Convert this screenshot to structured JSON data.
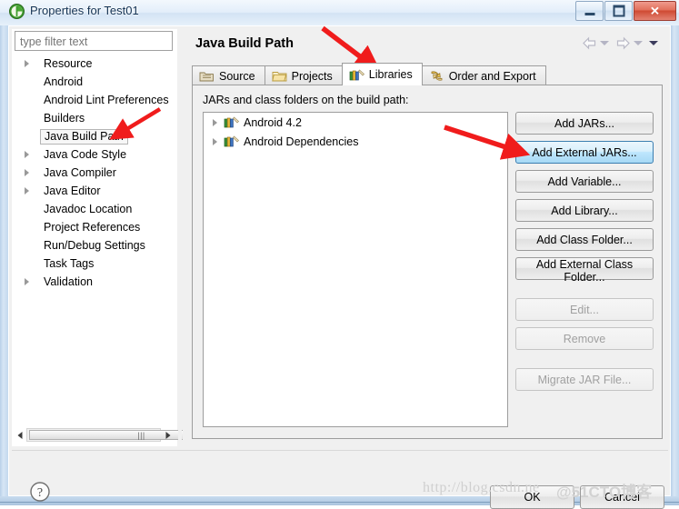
{
  "window": {
    "title": "Properties for Test01",
    "icon": "eclipse-properties-icon",
    "minimize_label": "",
    "maximize_label": "",
    "close_label": "✕"
  },
  "sidebar": {
    "filter": {
      "placeholder": "type filter text",
      "value": ""
    },
    "items": [
      {
        "label": "Resource",
        "expandable": true,
        "selected": false
      },
      {
        "label": "Android",
        "expandable": false,
        "selected": false
      },
      {
        "label": "Android Lint Preferences",
        "expandable": false,
        "selected": false
      },
      {
        "label": "Builders",
        "expandable": false,
        "selected": false
      },
      {
        "label": "Java Build Path",
        "expandable": false,
        "selected": true
      },
      {
        "label": "Java Code Style",
        "expandable": true,
        "selected": false
      },
      {
        "label": "Java Compiler",
        "expandable": true,
        "selected": false
      },
      {
        "label": "Java Editor",
        "expandable": true,
        "selected": false
      },
      {
        "label": "Javadoc Location",
        "expandable": false,
        "selected": false
      },
      {
        "label": "Project References",
        "expandable": false,
        "selected": false
      },
      {
        "label": "Run/Debug Settings",
        "expandable": false,
        "selected": false
      },
      {
        "label": "Task Tags",
        "expandable": false,
        "selected": false
      },
      {
        "label": "Validation",
        "expandable": true,
        "selected": false
      }
    ],
    "scrollbar": {
      "left_arrow": "◀",
      "right_arrow": "▶",
      "grip": "‖‖"
    }
  },
  "main": {
    "title": "Java Build Path",
    "nav": {
      "back_icon": "back-arrow-icon",
      "back_menu_icon": "chevron-down-icon",
      "forward_icon": "forward-arrow-icon",
      "forward_menu_icon": "chevron-down-icon",
      "menu_icon": "chevron-down-icon"
    },
    "tabs": [
      {
        "label": "Source",
        "icon": "source-folder-icon",
        "active": false
      },
      {
        "label": "Projects",
        "icon": "projects-folder-icon",
        "active": false
      },
      {
        "label": "Libraries",
        "icon": "libraries-books-icon",
        "active": true
      },
      {
        "label": "Order and Export",
        "icon": "order-export-icon",
        "active": false
      }
    ],
    "list_label": "JARs and class folders on the build path:",
    "jars": [
      {
        "label": "Android 4.2",
        "icon": "library-books-icon",
        "expandable": true
      },
      {
        "label": "Android Dependencies",
        "icon": "library-books-icon",
        "expandable": true
      }
    ],
    "buttons": [
      {
        "label": "Add JARs...",
        "state": "normal"
      },
      {
        "label": "Add External JARs...",
        "state": "hover"
      },
      {
        "label": "Add Variable...",
        "state": "normal"
      },
      {
        "label": "Add Library...",
        "state": "normal"
      },
      {
        "label": "Add Class Folder...",
        "state": "normal"
      },
      {
        "label": "Add External Class Folder...",
        "state": "normal"
      }
    ],
    "buttons2": [
      {
        "label": "Edit...",
        "state": "disabled"
      },
      {
        "label": "Remove",
        "state": "disabled"
      }
    ],
    "buttons3": [
      {
        "label": "Migrate JAR File...",
        "state": "disabled"
      }
    ]
  },
  "footer": {
    "help_icon": "help-question-icon",
    "ok_label": "OK",
    "cancel_label": "Cancel"
  },
  "watermark": {
    "url": "http://blog.csdn.ne",
    "brand": "@51CTO博客"
  }
}
